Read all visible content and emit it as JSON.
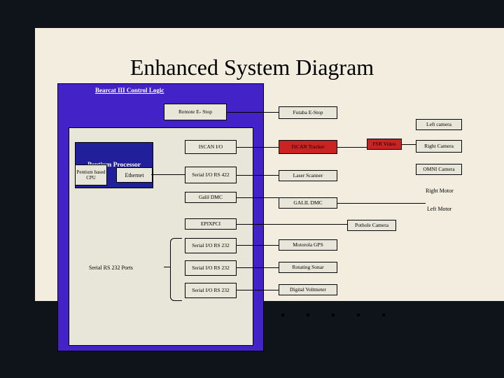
{
  "title": "Enhanced System Diagram",
  "outer_label": "Bearcat III Control Logic",
  "pp_label": "Pentium Processor",
  "cpu": "Pentium based CPU",
  "ethernet": "Ethernet",
  "remote_estop": "Remote E- Stop",
  "futaba_estop": "Futaba E-Stop",
  "left_camera": "Left camera",
  "fsr_video": "FSR Video",
  "right_camera": "Right Camera",
  "omni_camera": "OMNI Camera",
  "right_motor": "Right Motor",
  "left_motor": "Left Motor",
  "pothole": "Pothole Camera",
  "iscan_io": "ISCAN I/O",
  "iscan_tracker": "ISCAN Tracker",
  "serial_rs422": "Serial I/O RS 422",
  "laser_scanner": "Laser Scanner",
  "galil_left": "Galil DMC",
  "galil_right": "GALIL DMC",
  "epixpci": "EPIXPCI",
  "s1": "Serial I/O RS 232",
  "s2": "Serial I/O RS 232",
  "s3": "Serial I/O RS 232",
  "gps": "Motorola GPS",
  "sonar": "Rotating Sonar",
  "voltmeter": "Digital Voltmeter",
  "serial_ports_label": "Serial RS 232 Ports"
}
